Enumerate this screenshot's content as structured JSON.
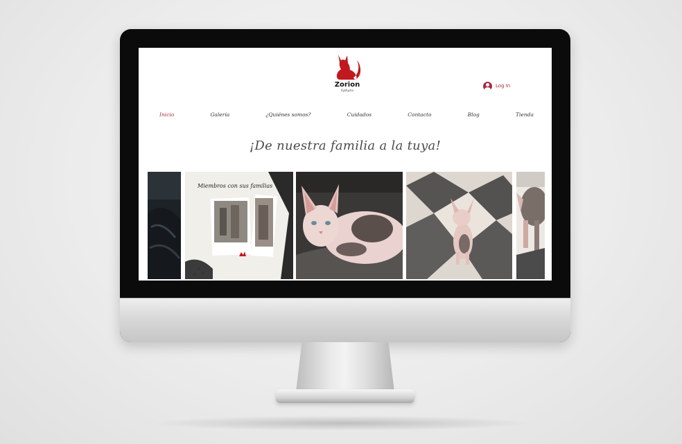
{
  "site": {
    "logo": {
      "name": "Zorion",
      "subtitle": "Sphynx"
    },
    "login_label": "Log In",
    "nav": [
      {
        "label": "Inicio",
        "active": true
      },
      {
        "label": "Galería",
        "active": false
      },
      {
        "label": "¿Quiénes somos?",
        "active": false
      },
      {
        "label": "Cuidados",
        "active": false
      },
      {
        "label": "Contacto",
        "active": false
      },
      {
        "label": "Blog",
        "active": false
      },
      {
        "label": "Tienda",
        "active": false
      }
    ],
    "headline": "¡De nuestra familia a la tuya!",
    "gallery": {
      "collage_title": "Miembros con sus familias"
    }
  },
  "colors": {
    "brand": "#a62a44",
    "logo_red": "#c0191f",
    "text": "#333333"
  },
  "icons": {
    "logo": "cat-silhouette-icon",
    "login": "user-avatar-icon"
  }
}
